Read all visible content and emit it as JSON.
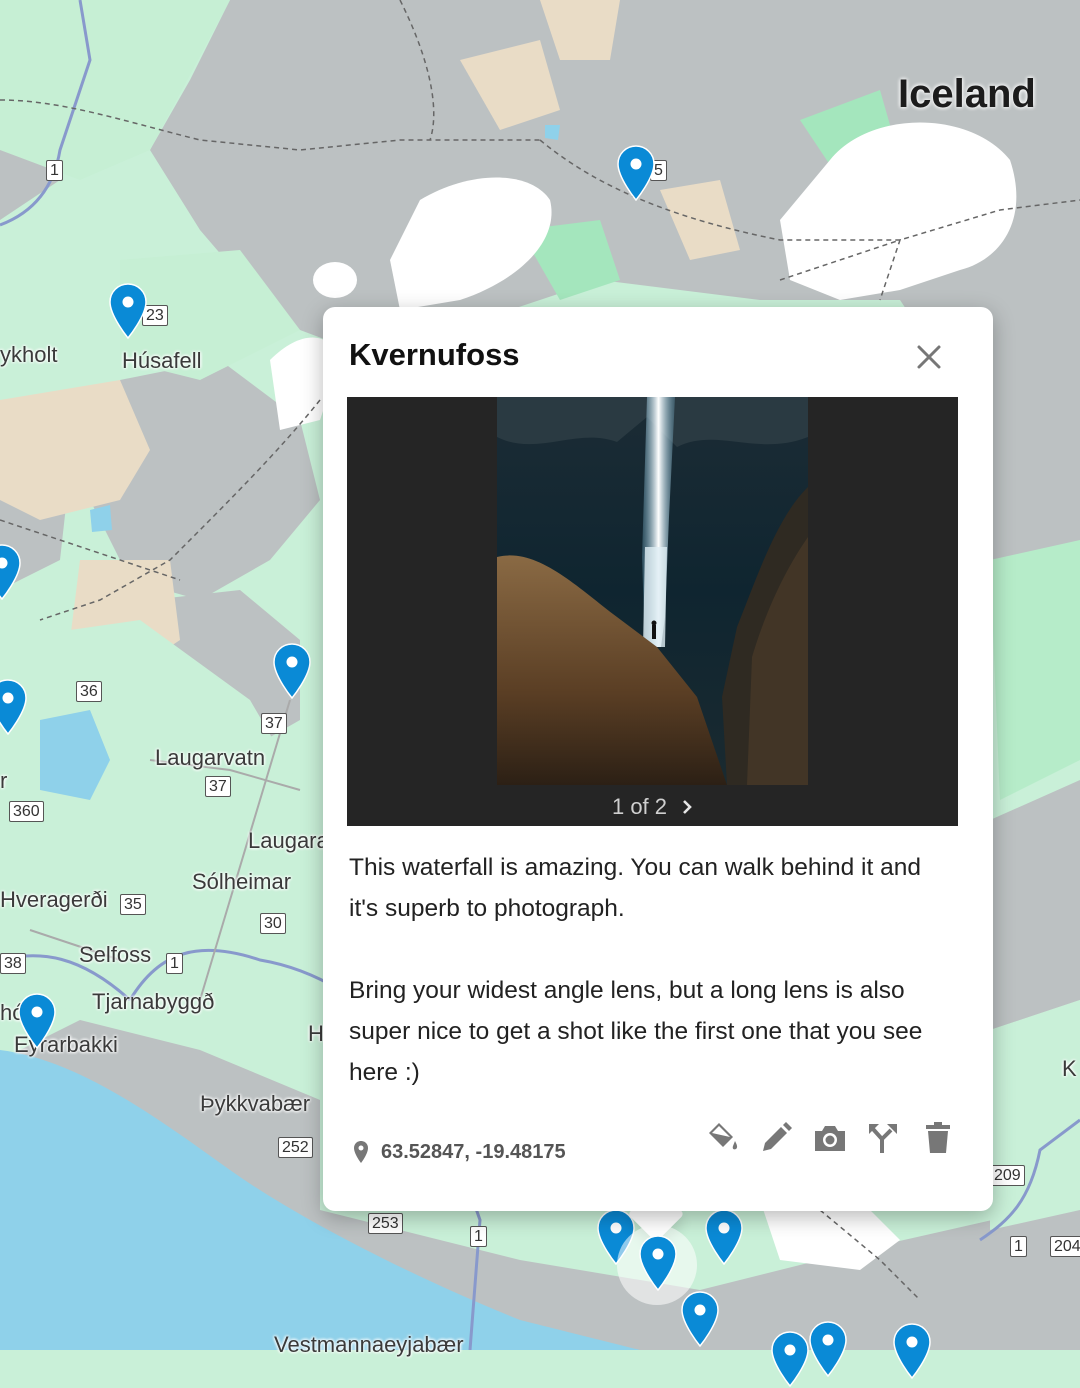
{
  "map": {
    "region_label": "Iceland",
    "place_labels": [
      "ykholt",
      "Húsafell",
      "Laugarvatn",
      "Laugarа",
      "Sólheimar",
      "Hveragerði",
      "Selfoss",
      "Tjarnabyggð",
      "Eyrarbakki",
      "Þykkvabær",
      "Vestmannaeyjabær",
      "H",
      "hó",
      "r",
      "K"
    ],
    "road_shields": [
      "1",
      "5",
      "23",
      "36",
      "37",
      "37",
      "360",
      "35",
      "30",
      "38",
      "1",
      "252",
      "253",
      "1",
      "209",
      "1",
      "204"
    ],
    "pin_color": "#0a8ad6",
    "water_color": "#8fd1ea",
    "land_color": "#c9f0d8",
    "terrain_color": "#b9bec0"
  },
  "popup": {
    "title": "Kvernufoss",
    "gallery_counter": "1 of 2",
    "description": [
      "This waterfall is amazing. You can walk behind it and it's superb to photograph.",
      "Bring your widest angle lens, but a long lens is also super nice to get a shot like the first one that you see here :)"
    ],
    "coordinates": "63.52847, -19.48175",
    "icons": {
      "close": "close-icon",
      "next": "chevron-right-icon",
      "location": "location-pin-icon",
      "tools": [
        "paint-bucket-icon",
        "pencil-icon",
        "camera-icon",
        "route-fork-icon",
        "trash-icon"
      ]
    }
  }
}
